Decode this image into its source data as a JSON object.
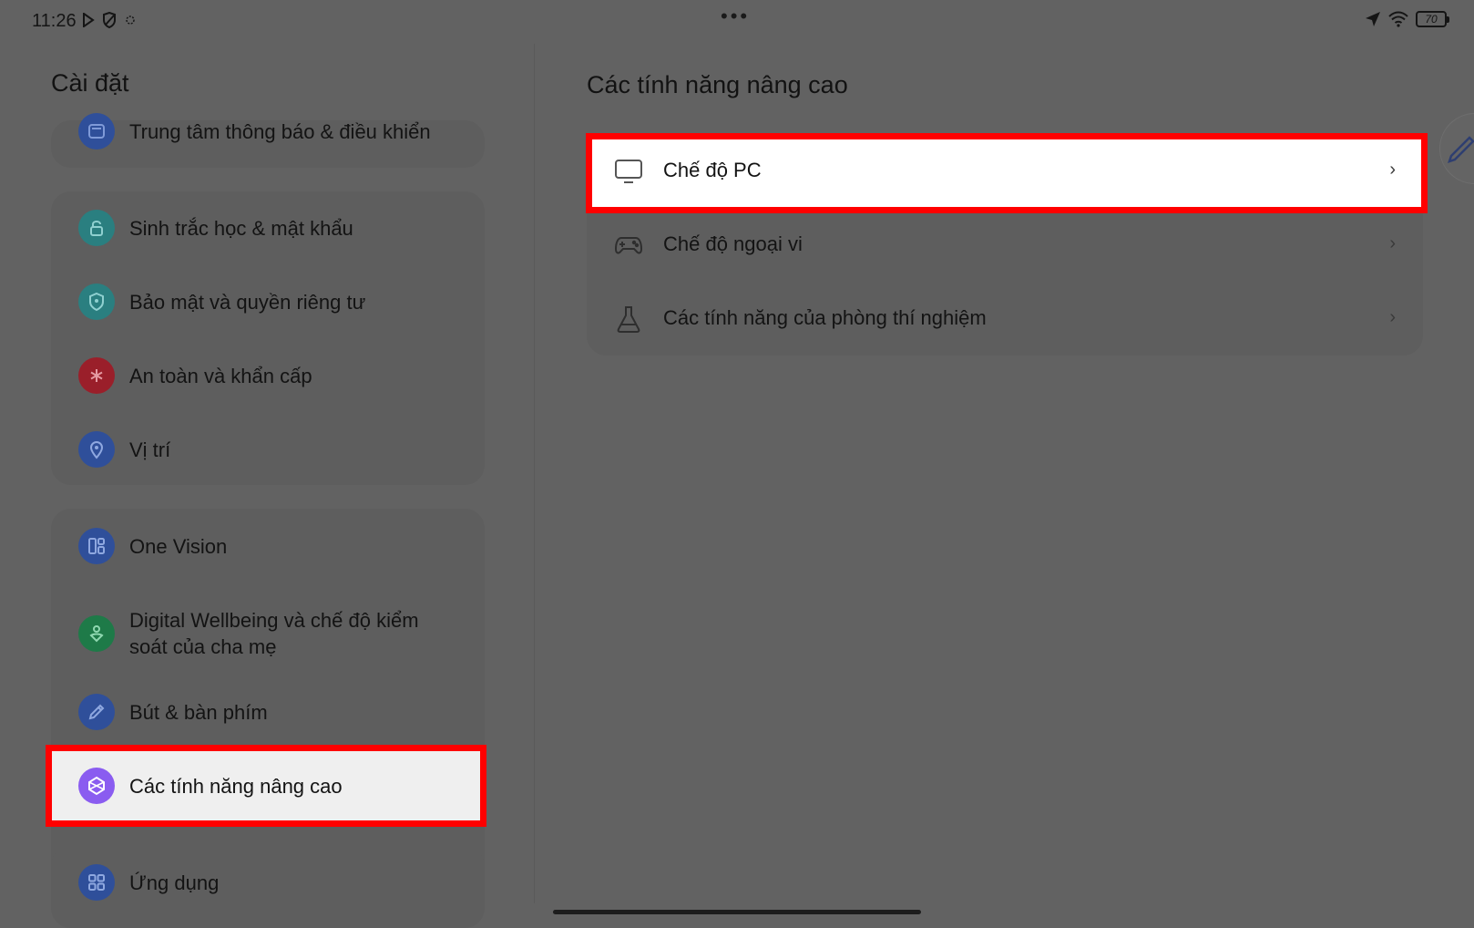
{
  "status_bar": {
    "time": "11:26",
    "battery": "70",
    "more": "•••",
    "icons_left": [
      "play-store-icon",
      "shield-icon",
      "circle-icon"
    ],
    "icons_right": [
      "location-arrow-icon",
      "wifi-icon",
      "battery-icon"
    ]
  },
  "left_pane": {
    "title": "Cài đặt",
    "items": [
      {
        "label": "Trung tâm thông báo & điều khiển",
        "icon": "notification-center-icon",
        "color": "#2f4f9a"
      },
      {
        "label": "Sinh trắc học & mật khẩu",
        "icon": "lock-icon",
        "color": "#2a7f80"
      },
      {
        "label": "Bảo mật và quyền riêng tư",
        "icon": "shield-icon",
        "color": "#2a7f80"
      },
      {
        "label": "An toàn và khẩn cấp",
        "icon": "asterisk-icon",
        "color": "#9a1f2a"
      },
      {
        "label": "Vị trí",
        "icon": "location-pin-icon",
        "color": "#2f4f9a"
      },
      {
        "label": "One Vision",
        "icon": "grid-layout-icon",
        "color": "#2f4f9a"
      },
      {
        "label": "Digital Wellbeing và chế độ kiểm soát của cha mẹ",
        "icon": "wellbeing-icon",
        "color": "#1e7a48"
      },
      {
        "label": "Bút & bàn phím",
        "icon": "pen-icon",
        "color": "#2f4f9a"
      },
      {
        "label": "Các tính năng nâng cao",
        "icon": "advanced-features-icon",
        "color": "#8a5cf0"
      },
      {
        "label": "Ứng dụng",
        "icon": "apps-grid-icon",
        "color": "#2f4f9a"
      }
    ]
  },
  "right_pane": {
    "title": "Các tính năng nâng cao",
    "rows": [
      {
        "label": "Chế độ PC",
        "icon": "monitor-icon"
      },
      {
        "label": "Chế độ ngoại vi",
        "icon": "gamepad-icon"
      },
      {
        "label": "Các tính năng của phòng thí nghiệm",
        "icon": "flask-icon"
      }
    ],
    "chevron": "›"
  },
  "colors": {
    "highlight": "#ff0000",
    "dim_background": "#626262"
  }
}
